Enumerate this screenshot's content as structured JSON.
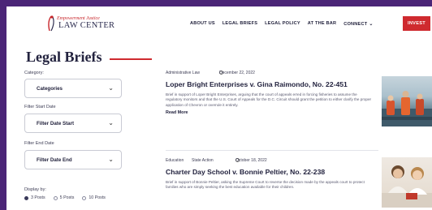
{
  "header": {
    "logo_top": "Empowerment Justice",
    "logo_main": "LAW CENTER",
    "nav": [
      {
        "label": "ABOUT US"
      },
      {
        "label": "LEGAL BRIEFS"
      },
      {
        "label": "LEGAL POLICY"
      },
      {
        "label": "AT THE BAR"
      },
      {
        "label": "CONNECT"
      }
    ],
    "invest_label": "INVEST"
  },
  "page_title": "Legal Briefs",
  "filters": {
    "category_label": "Category:",
    "category_value": "Categories",
    "start_label": "Filter Start Date",
    "start_value": "Filter Date Start",
    "end_label": "Filter End Date",
    "end_value": "Filter Date End",
    "display_label": "Display by:",
    "display_options": [
      "3 Posts",
      "5 Posts",
      "10 Posts"
    ],
    "display_selected": 0
  },
  "articles": [
    {
      "category": "Administrative Law",
      "tag": "",
      "date": "December 22, 2022",
      "title": "Loper Bright Enterprises v. Gina Raimondo, No. 22-451",
      "excerpt": "Brief in support of Loper Bright Enterprises, arguing that the court of appeals erred in forcing fisheries to assume the regulatory monitors and that the U.S. Court of Appeals for the D.C. Circuit should grant the petition to either clarify the proper application of Chevron or overrule it entirely.",
      "read_more": "Read More"
    },
    {
      "category": "Education",
      "tag": "State Action",
      "date": "October 18, 2022",
      "title": "Charter Day School v. Bonnie Peltier, No. 22-238",
      "excerpt": "Brief in support of Bonnie Peltier, asking the Supreme Court to reverse the decision made by the appeals court to protect families who are simply seeking the best education available for their children.",
      "read_more": ""
    }
  ]
}
